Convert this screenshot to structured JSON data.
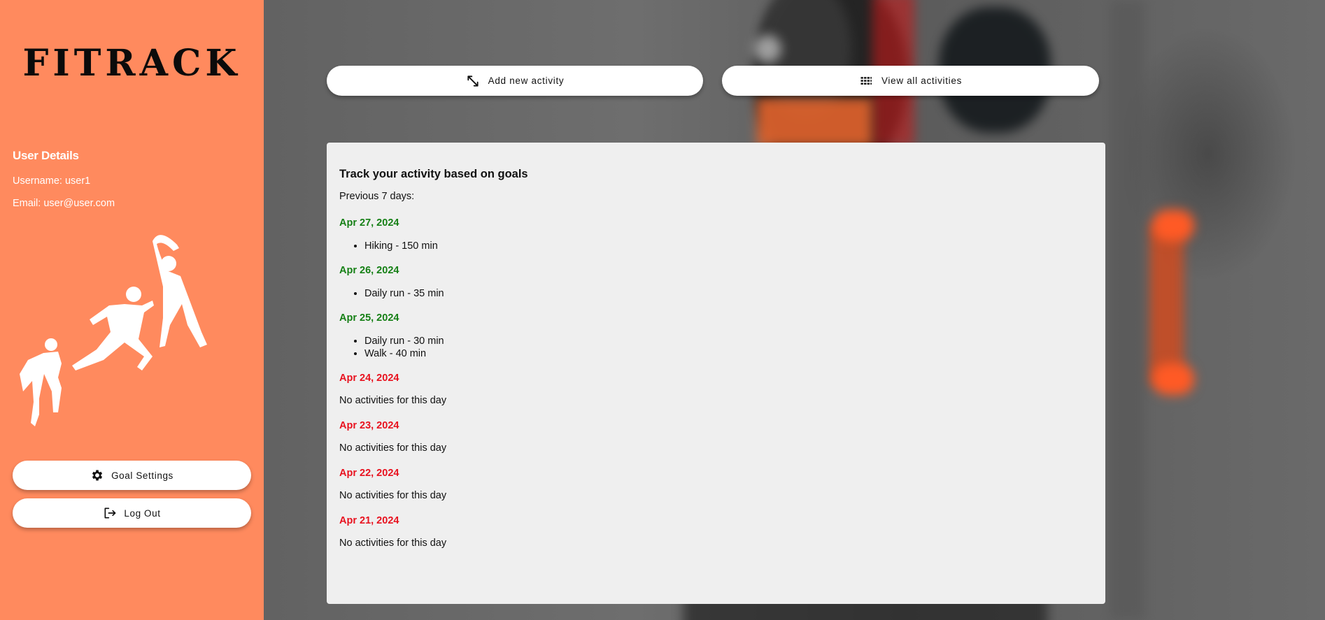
{
  "app": {
    "logo": "FITRACK"
  },
  "sidebar": {
    "user_details_title": "User Details",
    "username": "Username: user1",
    "email": "Email: user@user.com",
    "goal_settings_label": "Goal Settings",
    "logout_label": "Log Out"
  },
  "toolbar": {
    "add_label": "Add new activity",
    "view_label": "View all activities"
  },
  "card": {
    "title": "Track your activity based on goals",
    "subtitle": "Previous 7 days:",
    "no_activity_text": "No activities for this day",
    "days": [
      {
        "date": "Apr 27, 2024",
        "met": true,
        "activities": [
          "Hiking - 150 min"
        ]
      },
      {
        "date": "Apr 26, 2024",
        "met": true,
        "activities": [
          "Daily run - 35 min"
        ]
      },
      {
        "date": "Apr 25, 2024",
        "met": true,
        "activities": [
          "Daily run - 30 min",
          "Walk - 40 min"
        ]
      },
      {
        "date": "Apr 24, 2024",
        "met": false,
        "activities": []
      },
      {
        "date": "Apr 23, 2024",
        "met": false,
        "activities": []
      },
      {
        "date": "Apr 22, 2024",
        "met": false,
        "activities": []
      },
      {
        "date": "Apr 21, 2024",
        "met": false,
        "activities": []
      }
    ]
  },
  "colors": {
    "sidebar_bg": "#ff8a5e",
    "goal_met": "#168016",
    "goal_missed": "#e8121f"
  },
  "icons": {
    "add": "expand-arrows-icon",
    "view": "grid-icon",
    "goal": "gear-icon",
    "logout": "logout-icon"
  }
}
